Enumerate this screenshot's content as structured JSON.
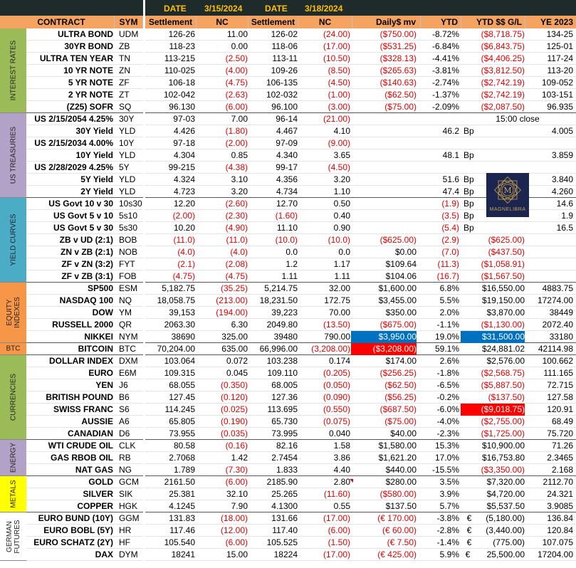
{
  "top": {
    "date1_label": "DATE",
    "date1": "3/15/2024",
    "date2_label": "DATE",
    "date2": "3/18/2024"
  },
  "header": {
    "contract": "CONTRACT",
    "sym": "SYM",
    "settle1": "Settlement",
    "nc1": "NC",
    "settle2": "Settlement",
    "nc2": "NC",
    "daily": "Daily$ mv",
    "ytd": "YTD",
    "ytd_gl": "YTD $$ G/L",
    "ye": "YE 2023"
  },
  "sections": [
    {
      "label": "INTEREST RATES",
      "color": "#9bbb59",
      "rows": 7
    },
    {
      "label": "US TREASURIES",
      "color": "#b3a2c7",
      "rows": 7
    },
    {
      "label": "YIELD CURVES",
      "color": "#4bacc6",
      "rows": 7
    },
    {
      "label": "EQUITY INDEXES",
      "color": "#f79646",
      "rows": 5
    },
    {
      "label": "BTC",
      "color": "#f79646",
      "rows": 1
    },
    {
      "label": "CURRENCIES",
      "color": "#9bbb59",
      "rows": 7
    },
    {
      "label": "ENERGY",
      "color": "#b3a2c7",
      "rows": 3
    },
    {
      "label": "METALS",
      "color": "#ffff00",
      "rows": 3
    },
    {
      "label": "GERMAN FUTURES",
      "color": "#ffffff",
      "rows": 4
    }
  ],
  "rows": [
    {
      "name": "ULTRA BOND",
      "sym": "UDM",
      "s1": "126-26",
      "n1": "11.00",
      "s2": "126-02",
      "n2": "(24.00)",
      "dm": "($750.00)",
      "ytd": "-8.72%",
      "yg": "($8,718.75)",
      "ye": "134-25",
      "red": [
        "n2",
        "dm",
        "yg"
      ]
    },
    {
      "name": "30YR BOND",
      "sym": "ZB",
      "s1": "118-23",
      "n1": "0.00",
      "s2": "118-06",
      "n2": "(17.00)",
      "dm": "($531.25)",
      "ytd": "-6.84%",
      "yg": "($6,843.75)",
      "ye": "125-01",
      "red": [
        "n2",
        "dm",
        "yg"
      ]
    },
    {
      "name": "ULTRA TEN YEAR",
      "sym": "TN",
      "s1": "113-215",
      "n1": "(2.50)",
      "s2": "113-11",
      "n2": "(10.50)",
      "dm": "($328.13)",
      "ytd": "-4.41%",
      "yg": "($4,406.25)",
      "ye": "117-24",
      "red": [
        "n1",
        "n2",
        "dm",
        "yg"
      ]
    },
    {
      "name": "10 YR NOTE",
      "sym": "ZN",
      "s1": "110-025",
      "n1": "(4.00)",
      "s2": "109-26",
      "n2": "(8.50)",
      "dm": "($265.63)",
      "ytd": "-3.81%",
      "yg": "($3,812.50)",
      "ye": "113-20",
      "red": [
        "n1",
        "n2",
        "dm",
        "yg"
      ]
    },
    {
      "name": "5 YR NOTE",
      "sym": "ZF",
      "s1": "106-18",
      "n1": "(4.75)",
      "s2": "106-135",
      "n2": "(4.50)",
      "dm": "($140.63)",
      "ytd": "-2.74%",
      "yg": "($2,742.19)",
      "ye": "109-052",
      "red": [
        "n1",
        "n2",
        "dm",
        "yg"
      ]
    },
    {
      "name": "2 YR NOTE",
      "sym": "ZT",
      "s1": "102-042",
      "n1": "(2.63)",
      "s2": "102-032",
      "n2": "(1.00)",
      "dm": "($62.50)",
      "ytd": "-1.37%",
      "yg": "($2,742.19)",
      "ye": "103-151",
      "red": [
        "n1",
        "n2",
        "dm",
        "yg"
      ]
    },
    {
      "name": "(Z25) SOFR",
      "sym": "SQ",
      "s1": "96.130",
      "n1": "(6.00)",
      "s2": "96.100",
      "n2": "(3.00)",
      "dm": "($75.00)",
      "ytd": "-2.09%",
      "yg": "($2,087.50)",
      "ye": "96.935",
      "red": [
        "n1",
        "n2",
        "dm",
        "yg"
      ],
      "sep": true
    },
    {
      "name": "US 2/15/2054 4.25%",
      "sym": "30Y",
      "s1": "97-03",
      "n1": "7.00",
      "s2": "96-14",
      "n2": "(21.00)",
      "dm": "",
      "ytd": "",
      "yg": "15:00 close",
      "ye": "",
      "red": [
        "n2"
      ]
    },
    {
      "name": "30Y Yield",
      "sym": "YLD",
      "s1": "4.426",
      "n1": "(1.80)",
      "s2": "4.467",
      "n2": "4.10",
      "dm": "",
      "ytd": "46.2",
      "yg": "Bp",
      "ye": "4.005",
      "red": [
        "n1"
      ]
    },
    {
      "name": "US 2/15/2034 4.00%",
      "sym": "10Y",
      "s1": "97-18",
      "n1": "(2.00)",
      "s2": "97-09",
      "n2": "(9.00)",
      "dm": "",
      "ytd": "",
      "yg": "",
      "ye": "",
      "red": [
        "n1",
        "n2"
      ]
    },
    {
      "name": "10Y Yield",
      "sym": "YLD",
      "s1": "4.304",
      "n1": "0.85",
      "s2": "4.340",
      "n2": "3.65",
      "dm": "",
      "ytd": "48.1",
      "yg": "Bp",
      "ye": "3.859",
      "red": []
    },
    {
      "name": "US 2/28/2029 4.25%",
      "sym": "5Y",
      "s1": "99-215",
      "n1": "(4.38)",
      "s2": "99-17",
      "n2": "(4.50)",
      "dm": "",
      "ytd": "",
      "yg": "",
      "ye": "",
      "red": [
        "n1",
        "n2"
      ]
    },
    {
      "name": "5Y Yield",
      "sym": "YLD",
      "s1": "4.324",
      "n1": "3.10",
      "s2": "4.356",
      "n2": "3.20",
      "dm": "",
      "ytd": "51.6",
      "yg": "Bp",
      "ye": "3.840",
      "red": []
    },
    {
      "name": "2Y Yield",
      "sym": "YLD",
      "s1": "4.723",
      "n1": "3.20",
      "s2": "4.734",
      "n2": "1.10",
      "dm": "",
      "ytd": "47.4",
      "yg": "Bp",
      "ye": "4.260",
      "red": [],
      "sep": true
    },
    {
      "name": "US Govt 10 v 30",
      "sym": "10s30",
      "s1": "12.20",
      "n1": "(2.60)",
      "s2": "12.70",
      "n2": "0.50",
      "dm": "",
      "ytd": "(1.9)",
      "yg": "Bp",
      "ye": "14.6",
      "red": [
        "n1",
        "ytd"
      ]
    },
    {
      "name": "US Govt 5 v 10",
      "sym": "5s10",
      "s1": "(2.00)",
      "n1": "(2.30)",
      "s2": "(1.60)",
      "n2": "0.40",
      "dm": "",
      "ytd": "(3.5)",
      "yg": "Bp",
      "ye": "1.9",
      "red": [
        "s1",
        "n1",
        "s2",
        "ytd"
      ]
    },
    {
      "name": "US Govt 5 v 30",
      "sym": "5s30",
      "s1": "10.20",
      "n1": "(4.90)",
      "s2": "11.10",
      "n2": "0.90",
      "dm": "",
      "ytd": "(5.4)",
      "yg": "Bp",
      "ye": "16.5",
      "red": [
        "n1",
        "ytd"
      ]
    },
    {
      "name": "ZB v UD (2:1)",
      "sym": "BOB",
      "s1": "(11.0)",
      "n1": "(11.0)",
      "s2": "(10.0)",
      "n2": "(10.0)",
      "dm": "($625.00)",
      "ytd": "(2.9)",
      "yg": "($625.00)",
      "ye": "",
      "red": [
        "s1",
        "n1",
        "s2",
        "n2",
        "dm",
        "ytd",
        "yg"
      ]
    },
    {
      "name": "ZN v ZB (2:1)",
      "sym": "NOB",
      "s1": "(4.0)",
      "n1": "(4.0)",
      "s2": "0.0",
      "n2": "0.0",
      "dm": "$0.00",
      "ytd": "(7.0)",
      "yg": "($437.50)",
      "ye": "",
      "red": [
        "s1",
        "n1",
        "ytd",
        "yg"
      ]
    },
    {
      "name": "ZF v ZN (3:2)",
      "sym": "FYT",
      "s1": "(2.1)",
      "n1": "(2.08)",
      "s2": "1.2",
      "n2": "1.17",
      "dm": "$109.64",
      "ytd": "(11.3)",
      "yg": "($1,058.91)",
      "ye": "",
      "red": [
        "s1",
        "n1",
        "ytd",
        "yg"
      ]
    },
    {
      "name": "ZF v ZB (3:1)",
      "sym": "FOB",
      "s1": "(4.75)",
      "n1": "(4.75)",
      "s2": "1.11",
      "n2": "1.11",
      "dm": "$104.06",
      "ytd": "(16.7)",
      "yg": "($1,567.50)",
      "ye": "",
      "red": [
        "s1",
        "n1",
        "ytd",
        "yg"
      ],
      "sep": true
    },
    {
      "name": "SP500",
      "sym": "ESM",
      "s1": "5,182.75",
      "n1": "(35.25)",
      "s2": "5,214.75",
      "n2": "32.00",
      "dm": "$1,600.00",
      "ytd": "6.8%",
      "yg": "$16,550.00",
      "ye": "4883.75",
      "red": [
        "n1"
      ]
    },
    {
      "name": "NASDAQ 100",
      "sym": "NQ",
      "s1": "18,058.75",
      "n1": "(213.00)",
      "s2": "18,231.50",
      "n2": "172.75",
      "dm": "$3,455.00",
      "ytd": "5.5%",
      "yg": "$19,150.00",
      "ye": "17274.00",
      "red": [
        "n1"
      ]
    },
    {
      "name": "DOW",
      "sym": "YM",
      "s1": "39,153",
      "n1": "(194.00)",
      "s2": "39,223",
      "n2": "70.00",
      "dm": "$350.00",
      "ytd": "2.0%",
      "yg": "$3,870.00",
      "ye": "38449",
      "red": [
        "n1"
      ]
    },
    {
      "name": "RUSSELL 2000",
      "sym": "QR",
      "s1": "2063.30",
      "n1": "6.30",
      "s2": "2049.80",
      "n2": "(13.50)",
      "dm": "($675.00)",
      "ytd": "-1.1%",
      "yg": "($1,130.00)",
      "ye": "2072.40",
      "red": [
        "n2",
        "dm",
        "yg"
      ]
    },
    {
      "name": "NIKKEI",
      "sym": "NYM",
      "s1": "38690",
      "n1": "325.00",
      "s2": "39480",
      "n2": "790.00",
      "dm": "$3,950.00",
      "ytd": "19.0%",
      "yg": "$31,500.00",
      "ye": "33180",
      "red": [],
      "bg_dm": "blue",
      "bg_yg": "blue",
      "sep": true
    },
    {
      "name": "BITCOIN",
      "sym": "BTC",
      "s1": "70,204.00",
      "n1": "635.00",
      "s2": "66,996.00",
      "n2": "(3,208.00)",
      "dm": "($3,208.00)",
      "ytd": "59.1%",
      "yg": "$24,881.02",
      "ye": "42114.98",
      "red": [
        "n2"
      ],
      "bg_dm": "red",
      "sep": true
    },
    {
      "name": "DOLLAR INDEX",
      "sym": "DXM",
      "s1": "103.064",
      "n1": "0.072",
      "s2": "103.238",
      "n2": "0.174",
      "dm": "$174.00",
      "ytd": "2.6%",
      "yg": "$2,576.00",
      "ye": "100.662",
      "red": []
    },
    {
      "name": "EURO",
      "sym": "E6M",
      "s1": "109.315",
      "n1": "0.045",
      "s2": "109.110",
      "n2": "(0.205)",
      "dm": "($256.25)",
      "ytd": "-1.8%",
      "yg": "($2,568.75)",
      "ye": "111.165",
      "red": [
        "n2",
        "dm",
        "yg"
      ]
    },
    {
      "name": "YEN",
      "sym": "J6",
      "s1": "68.055",
      "n1": "(0.350)",
      "s2": "68.005",
      "n2": "(0.050)",
      "dm": "($62.50)",
      "ytd": "-6.5%",
      "yg": "($5,887.50)",
      "ye": "72.715",
      "red": [
        "n1",
        "n2",
        "dm",
        "yg"
      ]
    },
    {
      "name": "BRITISH POUND",
      "sym": "B6",
      "s1": "127.45",
      "n1": "(0.120)",
      "s2": "127.36",
      "n2": "(0.090)",
      "dm": "($56.25)",
      "ytd": "-0.2%",
      "yg": "($137.50)",
      "ye": "127.58",
      "red": [
        "n1",
        "n2",
        "dm",
        "yg"
      ]
    },
    {
      "name": "SWISS FRANC",
      "sym": "S6",
      "s1": "114.245",
      "n1": "(0.025)",
      "s2": "113.695",
      "n2": "(0.550)",
      "dm": "($687.50)",
      "ytd": "-6.0%",
      "yg": "($9,018.75)",
      "ye": "120.91",
      "red": [
        "n1",
        "n2",
        "dm"
      ],
      "bg_yg": "red"
    },
    {
      "name": "AUSSIE",
      "sym": "A6",
      "s1": "65.805",
      "n1": "(0.190)",
      "s2": "65.730",
      "n2": "(0.075)",
      "dm": "($75.00)",
      "ytd": "-4.0%",
      "yg": "($2,755.00)",
      "ye": "68.49",
      "red": [
        "n1",
        "n2",
        "dm",
        "yg"
      ]
    },
    {
      "name": "CANADIAN",
      "sym": "D6",
      "s1": "73.955",
      "n1": "(0.035)",
      "s2": "73.995",
      "n2": "0.040",
      "dm": "$40.00",
      "ytd": "-2.3%",
      "yg": "($1,725.00)",
      "ye": "75.720",
      "red": [
        "n1",
        "yg"
      ],
      "sep": true
    },
    {
      "name": "WTI CRUDE OIL",
      "sym": "CLK",
      "s1": "80.58",
      "n1": "(0.16)",
      "s2": "82.16",
      "n2": "1.58",
      "dm": "$1,580.00",
      "ytd": "15.3%",
      "yg": "$10,900.00",
      "ye": "71.26",
      "red": [
        "n1"
      ]
    },
    {
      "name": "GAS RBOB OIL",
      "sym": "RB",
      "s1": "2.7068",
      "n1": "1.42",
      "s2": "2.7454",
      "n2": "3.86",
      "dm": "$1,621.20",
      "ytd": "17.0%",
      "yg": "$16,753.80",
      "ye": "2.3465",
      "red": []
    },
    {
      "name": "NAT GAS",
      "sym": "NG",
      "s1": "1.789",
      "n1": "(7.30)",
      "s2": "1.833",
      "n2": "4.40",
      "dm": "$440.00",
      "ytd": "-15.5%",
      "yg": "($3,350.00)",
      "ye": "2.168",
      "red": [
        "n1",
        "yg"
      ],
      "sep": true
    },
    {
      "name": "GOLD",
      "sym": "GCM",
      "s1": "2161.50",
      "n1": "(6.00)",
      "s2": "2185.90",
      "n2": "2.80",
      "dm": "$280.00",
      "ytd": "3.5%",
      "yg": "$7,320.00",
      "ye": "2112.70",
      "red": [
        "n1"
      ]
    },
    {
      "name": "SILVER",
      "sym": "SIK",
      "s1": "25.381",
      "n1": "32.10",
      "s2": "25.265",
      "n2": "(11.60)",
      "dm": "($580.00)",
      "ytd": "3.9%",
      "yg": "$4,720.00",
      "ye": "24.321",
      "red": [
        "n2",
        "dm"
      ]
    },
    {
      "name": "COPPER",
      "sym": "HGK",
      "s1": "4.1245",
      "n1": "7.90",
      "s2": "4.1300",
      "n2": "0.55",
      "dm": "$137.50",
      "ytd": "5.7%",
      "yg": "$5,537.50",
      "ye": "3.9085",
      "red": [],
      "sep": true
    },
    {
      "name": "EURO BUND (10Y)",
      "sym": "GGM",
      "s1": "131.83",
      "n1": "(18.00)",
      "s2": "131.66",
      "n2": "(17.00)",
      "dm": "(€ 170.00)",
      "ytd": "-3.8%",
      "yg": "€      (5,180.00)",
      "ye": "136.84",
      "red": [
        "n1",
        "n2",
        "dm"
      ]
    },
    {
      "name": "EURO BOBL (5Y)",
      "sym": "HR",
      "s1": "117.46",
      "n1": "(12.00)",
      "s2": "117.40",
      "n2": "(6.00)",
      "dm": "(€ 60.00)",
      "ytd": "-2.8%",
      "yg": "€      (3,440.00)",
      "ye": "120.84",
      "red": [
        "n1",
        "n2",
        "dm"
      ]
    },
    {
      "name": "EURO SCHATZ (2Y)",
      "sym": "HF",
      "s1": "105.540",
      "n1": "(6.00)",
      "s2": "105.525",
      "n2": "(1.50)",
      "dm": "(€ 7.50)",
      "ytd": "-1.4%",
      "yg": "€         (775.00)",
      "ye": "107.075",
      "red": [
        "n1",
        "n2",
        "dm"
      ]
    },
    {
      "name": "DAX",
      "sym": "DYM",
      "s1": "18241",
      "n1": "15.00",
      "s2": "18224",
      "n2": "(17.00)",
      "dm": "(€ 425.00)",
      "ytd": "5.9%",
      "yg": "€       25,500.00",
      "ye": "17204.00",
      "red": [
        "n2",
        "dm"
      ]
    }
  ],
  "logo": {
    "text": "MAGNELIBRA",
    "monogram": "M",
    "icon": "geometric-star-logo"
  }
}
